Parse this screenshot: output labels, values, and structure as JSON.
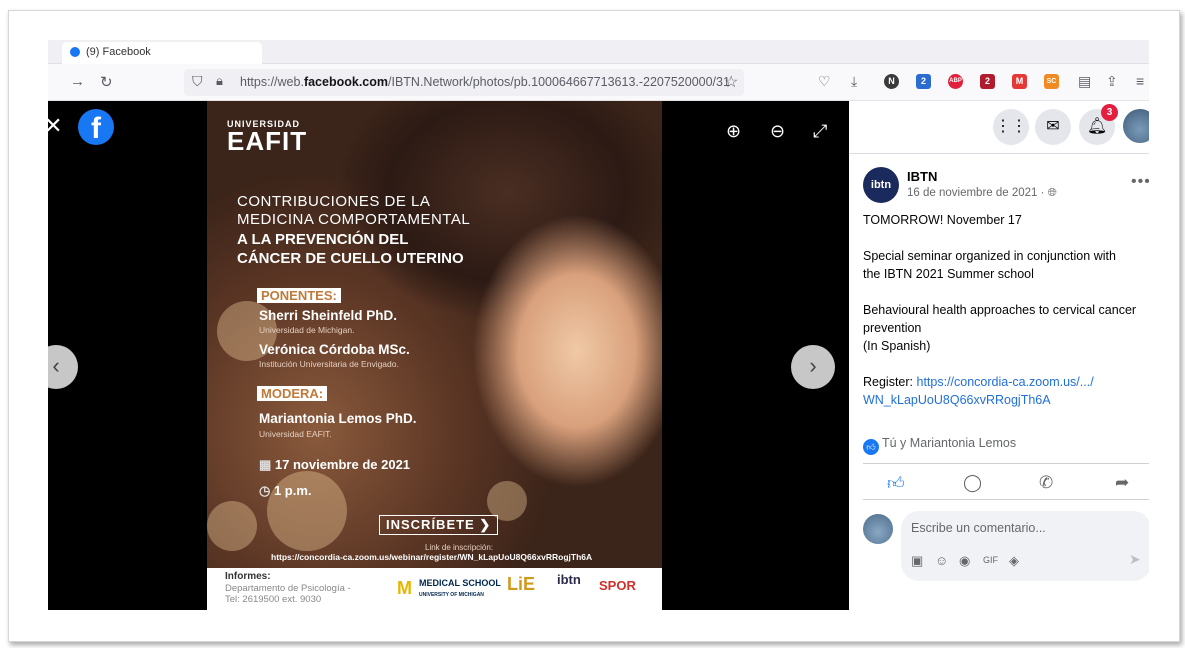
{
  "browser": {
    "tab": {
      "title": "(9) Facebook"
    },
    "url_prefix": "https://web.",
    "url_domain": "facebook.com",
    "url_path": "/IBTN.Network/photos/pb.100064667713613.-2207520000/31",
    "extension_badges": [
      "N",
      "2",
      "ABP",
      "2",
      "M",
      "SC"
    ]
  },
  "viewer": {
    "close": "✕",
    "logo": "f",
    "zoom_in": "⊕",
    "zoom_out": "⊖",
    "fullscreen": "⤢",
    "prev": "‹",
    "next": "›"
  },
  "poster": {
    "university_small": "UNIVERSIDAD",
    "university_big": "EAFIT",
    "title_line1": "CONTRIBUCIONES  DE LA",
    "title_line2": "MEDICINA COMPORTAMENTAL",
    "title_line3": "A LA PREVENCIÓN DEL",
    "title_line4": "CÁNCER DE CUELLO UTERINO",
    "speakers_tag": "PONENTES:",
    "speaker1_name": "Sherri Sheinfeld PhD.",
    "speaker1_aff": "Universidad de Michigan.",
    "speaker2_name": "Verónica Córdoba MSc.",
    "speaker2_aff": "Institución Universitaria de Envigado.",
    "moderator_tag": "MODERA:",
    "moderator_name": "Mariantonia Lemos PhD.",
    "moderator_aff": "Universidad EAFIT.",
    "date": "17 noviembre de 2021",
    "time": "1 p.m.",
    "register_button": "INSCRÍBETE ❯",
    "link_label": "Link de inscripción:",
    "link": "https://concordia-ca.zoom.us/webinar/register/WN_kLapUoU8Q66xvRRogjTh6A",
    "footer_title": "Informes:",
    "footer_line1": "Departamento de Psicología -",
    "footer_line2": "Tel: 2619500 ext. 9030",
    "logo_m": "M",
    "logo_medical": "MEDICAL SCHOOL",
    "logo_medical_sub": "UNIVERSITY OF MICHIGAN",
    "logo_lie": "LiE",
    "logo_ibtn": "ibtn",
    "logo_spor": "SPOR"
  },
  "panel": {
    "notification_count": "3",
    "page_avatar_text": "ibtn",
    "page_name": "IBTN",
    "post_time": "16 de noviembre de 2021 · ",
    "post": {
      "line1": "TOMORROW! November 17",
      "line2": "Special seminar organized in conjunction with",
      "line3": "the IBTN 2021 Summer school",
      "line4": "Behavioural health approaches to cervical cancer",
      "line5": "prevention",
      "line6": "(In Spanish)",
      "register_label": "Register: ",
      "register_link1": "https://concordia-ca.zoom.us/.../",
      "register_link2": "WN_kLapUoU8Q66xvRRogjTh6A"
    },
    "reactions_text": "Tú y Mariantonia Lemos",
    "comment_placeholder": "Escribe un comentario..."
  }
}
